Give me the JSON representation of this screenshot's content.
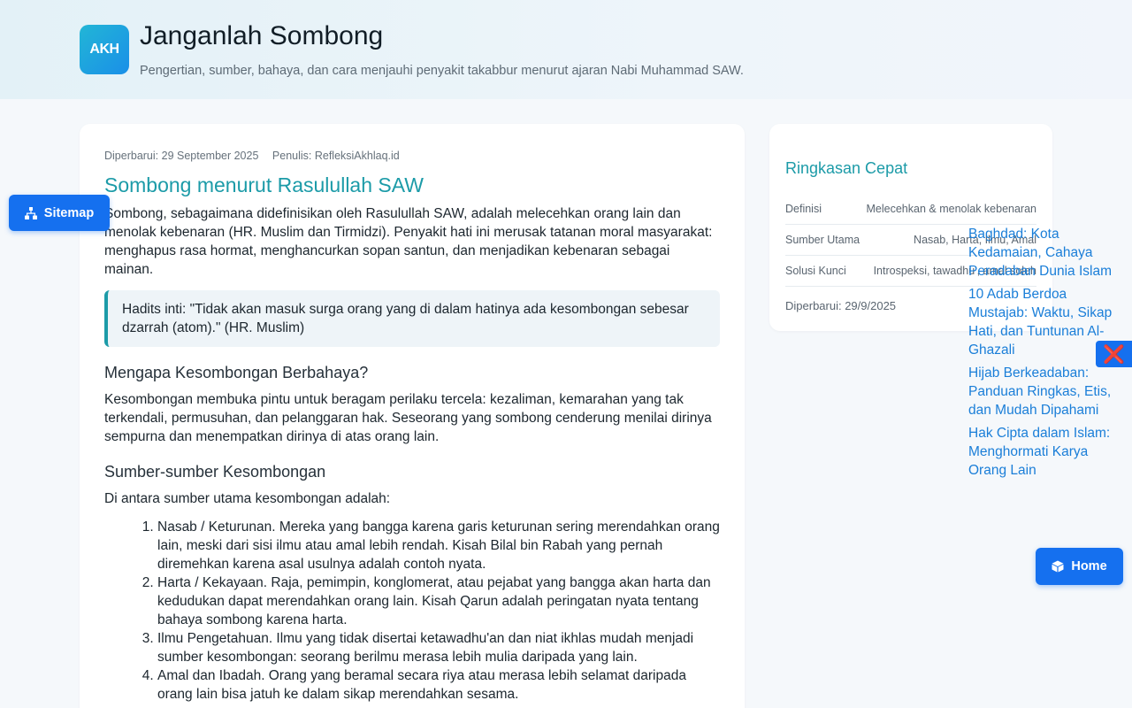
{
  "header": {
    "logo_text": "AKH",
    "title": "Janganlah Sombong",
    "subtitle": "Pengertian, sumber, bahaya, dan cara menjauhi penyakit takabbur menurut ajaran Nabi Muhammad SAW."
  },
  "article": {
    "updated": "Diperbarui: 29 September 2025",
    "author": "Penulis: RefleksiAkhlaq.id",
    "heading": "Sombong menurut Rasulullah SAW",
    "intro": "Sombong, sebagaimana didefinisikan oleh Rasulullah SAW, adalah melecehkan orang lain dan menolak kebenaran (HR. Muslim dan Tirmidzi). Penyakit hati ini merusak tatanan moral masyarakat: menghapus rasa hormat, menghancurkan sopan santun, dan menjadikan kebenaran sebagai mainan.",
    "quote": "Hadits inti: \"Tidak akan masuk surga orang yang di dalam hatinya ada kesombongan sebesar dzarrah (atom).\" (HR. Muslim)",
    "section1_heading": "Mengapa Kesombongan Berbahaya?",
    "section1_text": "Kesombongan membuka pintu untuk beragam perilaku tercela: kezaliman, kemarahan yang tak terkendali, permusuhan, dan pelanggaran hak. Seseorang yang sombong cenderung menilai dirinya sempurna dan menempatkan dirinya di atas orang lain.",
    "section2_heading": "Sumber-sumber Kesombongan",
    "section2_text": "Di antara sumber utama kesombongan adalah:",
    "sources": [
      "Nasab / Keturunan. Mereka yang bangga karena garis keturunan sering merendahkan orang lain, meski dari sisi ilmu atau amal lebih rendah. Kisah Bilal bin Rabah yang pernah diremehkan karena asal usulnya adalah contoh nyata.",
      "Harta / Kekayaan. Raja, pemimpin, konglomerat, atau pejabat yang bangga akan harta dan kedudukan dapat merendahkan orang lain. Kisah Qarun adalah peringatan nyata tentang bahaya sombong karena harta.",
      "Ilmu Pengetahuan. Ilmu yang tidak disertai ketawadhu'an dan niat ikhlas mudah menjadi sumber kesombongan: seorang berilmu merasa lebih mulia daripada yang lain.",
      "Amal dan Ibadah. Orang yang beramal secara riya atau merasa lebih selamat daripada orang lain bisa jatuh ke dalam sikap merendahkan sesama."
    ]
  },
  "summary": {
    "title": "Ringkasan Cepat",
    "rows": [
      {
        "label": "Definisi",
        "value": "Melecehkan & menolak kebenaran"
      },
      {
        "label": "Sumber Utama",
        "value": "Nasab, Harta, Ilmu, Amal"
      },
      {
        "label": "Solusi Kunci",
        "value": "Introspeksi, tawadhu', amal soleh"
      }
    ],
    "updated": "Diperbarui: 29/9/2025"
  },
  "related": [
    "Baghdad: Kota Kedamaian, Cahaya Peradaban Dunia Islam",
    "10 Adab Berdoa Mustajab: Waktu, Sikap Hati, dan Tuntunan Al-Ghazali",
    "Hijab Berkeadaban: Panduan Ringkas, Etis, dan Mudah Dipahami",
    "Hak Cipta dalam Islam: Menghormati Karya Orang Lain"
  ],
  "buttons": {
    "sitemap": "Sitemap",
    "home": "Home",
    "close_glyph": "❌"
  },
  "colors": {
    "accent": "#1c9ba8",
    "button": "#1570ef",
    "link": "#1a7ed8"
  },
  "icons": {
    "sitemap": "sitemap-icon",
    "home": "home-icon",
    "close": "close-icon"
  }
}
